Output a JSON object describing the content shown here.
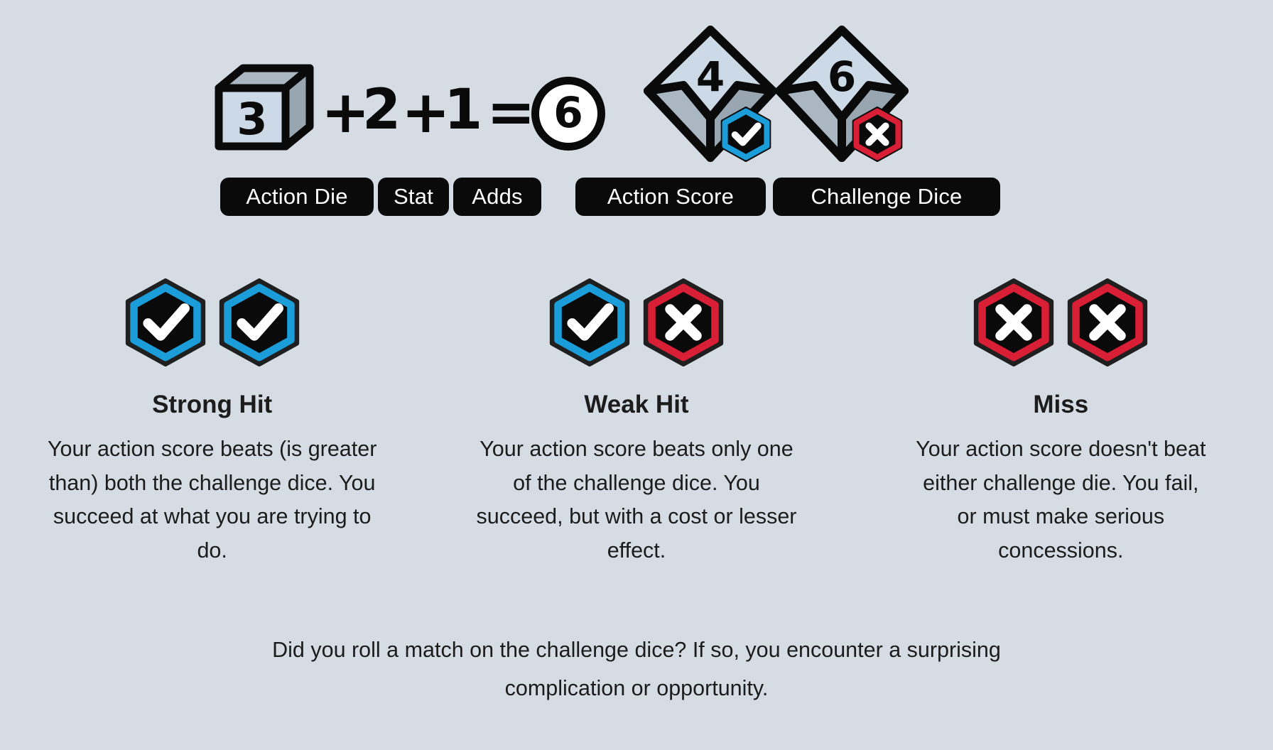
{
  "background_color": "#d5dce4",
  "colors": {
    "ink": "#0a0a0a",
    "text": "#1c1c1c",
    "success_blue": "#1b9dd9",
    "failure_red": "#d81f35",
    "badge_dark": "#1f1f1f",
    "die_face_light": "#ccd9e6",
    "die_face_mid": "#aab7c2",
    "die_face_dark": "#98a6b1"
  },
  "formula": {
    "action_die": {
      "label": "Action Die",
      "value": "3",
      "icon": "cube-die-icon"
    },
    "plus_1": "+",
    "stat": {
      "label": "Stat",
      "value": "2"
    },
    "plus_2": "+",
    "adds": {
      "label": "Adds",
      "value": "1"
    },
    "equals": "=",
    "action_score": {
      "label": "Action Score",
      "value": "6",
      "icon": "circle-score-icon"
    },
    "challenge_dice": {
      "label": "Challenge Dice",
      "dice": [
        {
          "value": "4",
          "icon": "d10-die-icon",
          "badge": "check-badge-icon",
          "badge_color": "#1b9dd9"
        },
        {
          "value": "6",
          "icon": "d10-die-icon",
          "badge": "cross-badge-icon",
          "badge_color": "#d81f35"
        }
      ]
    }
  },
  "outcomes": [
    {
      "key": "strong-hit",
      "title": "Strong Hit",
      "description": "Your action score beats (is greater than) both the challenge dice. You succeed at what you are trying to do.",
      "badges": [
        {
          "icon": "check-badge-icon",
          "color": "#1b9dd9"
        },
        {
          "icon": "check-badge-icon",
          "color": "#1b9dd9"
        }
      ]
    },
    {
      "key": "weak-hit",
      "title": "Weak Hit",
      "description": "Your action score beats only one of the challenge dice. You succeed, but with a cost or lesser effect.",
      "badges": [
        {
          "icon": "check-badge-icon",
          "color": "#1b9dd9"
        },
        {
          "icon": "cross-badge-icon",
          "color": "#d81f35"
        }
      ]
    },
    {
      "key": "miss",
      "title": "Miss",
      "description": "Your action score doesn't beat either challenge die. You fail, or must make serious concessions.",
      "badges": [
        {
          "icon": "cross-badge-icon",
          "color": "#d81f35"
        },
        {
          "icon": "cross-badge-icon",
          "color": "#d81f35"
        }
      ]
    }
  ],
  "footer_note": "Did you roll a match on the challenge dice? If so, you encounter a surprising complication or opportunity."
}
